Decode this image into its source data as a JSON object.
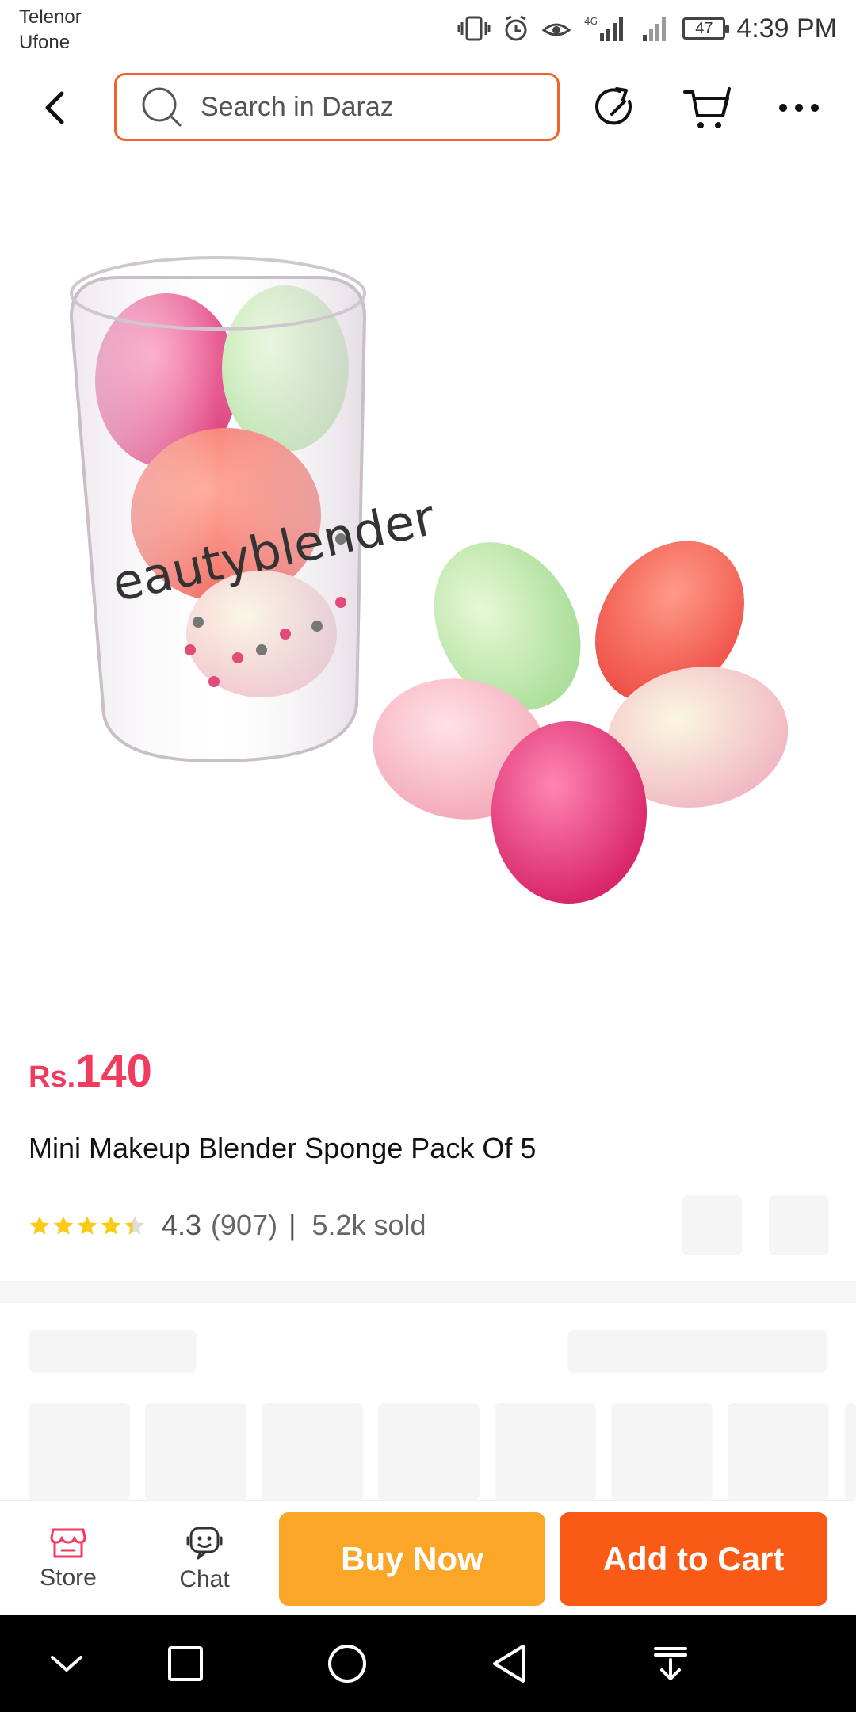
{
  "status_bar": {
    "carrier_1": "Telenor",
    "carrier_2": "Ufone",
    "network": "4G",
    "battery": "47",
    "time": "4:39 PM"
  },
  "header": {
    "search_placeholder": "Search in Daraz",
    "accent": "#f1632a"
  },
  "product": {
    "image_alt": "Mini makeup blender sponges",
    "price_currency": "Rs.",
    "price_value": "140",
    "price_color": "#f23b5f",
    "title": "Mini Makeup Blender Sponge Pack Of 5",
    "rating_value": "4.3",
    "rating_stars": 4.3,
    "reviews": "(907)",
    "separator": "|",
    "sold": "5.2k sold"
  },
  "action_bar": {
    "store_label": "Store",
    "chat_label": "Chat",
    "buy_now_label": "Buy Now",
    "add_to_cart_label": "Add to Cart",
    "buy_color": "#fba627",
    "cart_color": "#f95a16"
  }
}
